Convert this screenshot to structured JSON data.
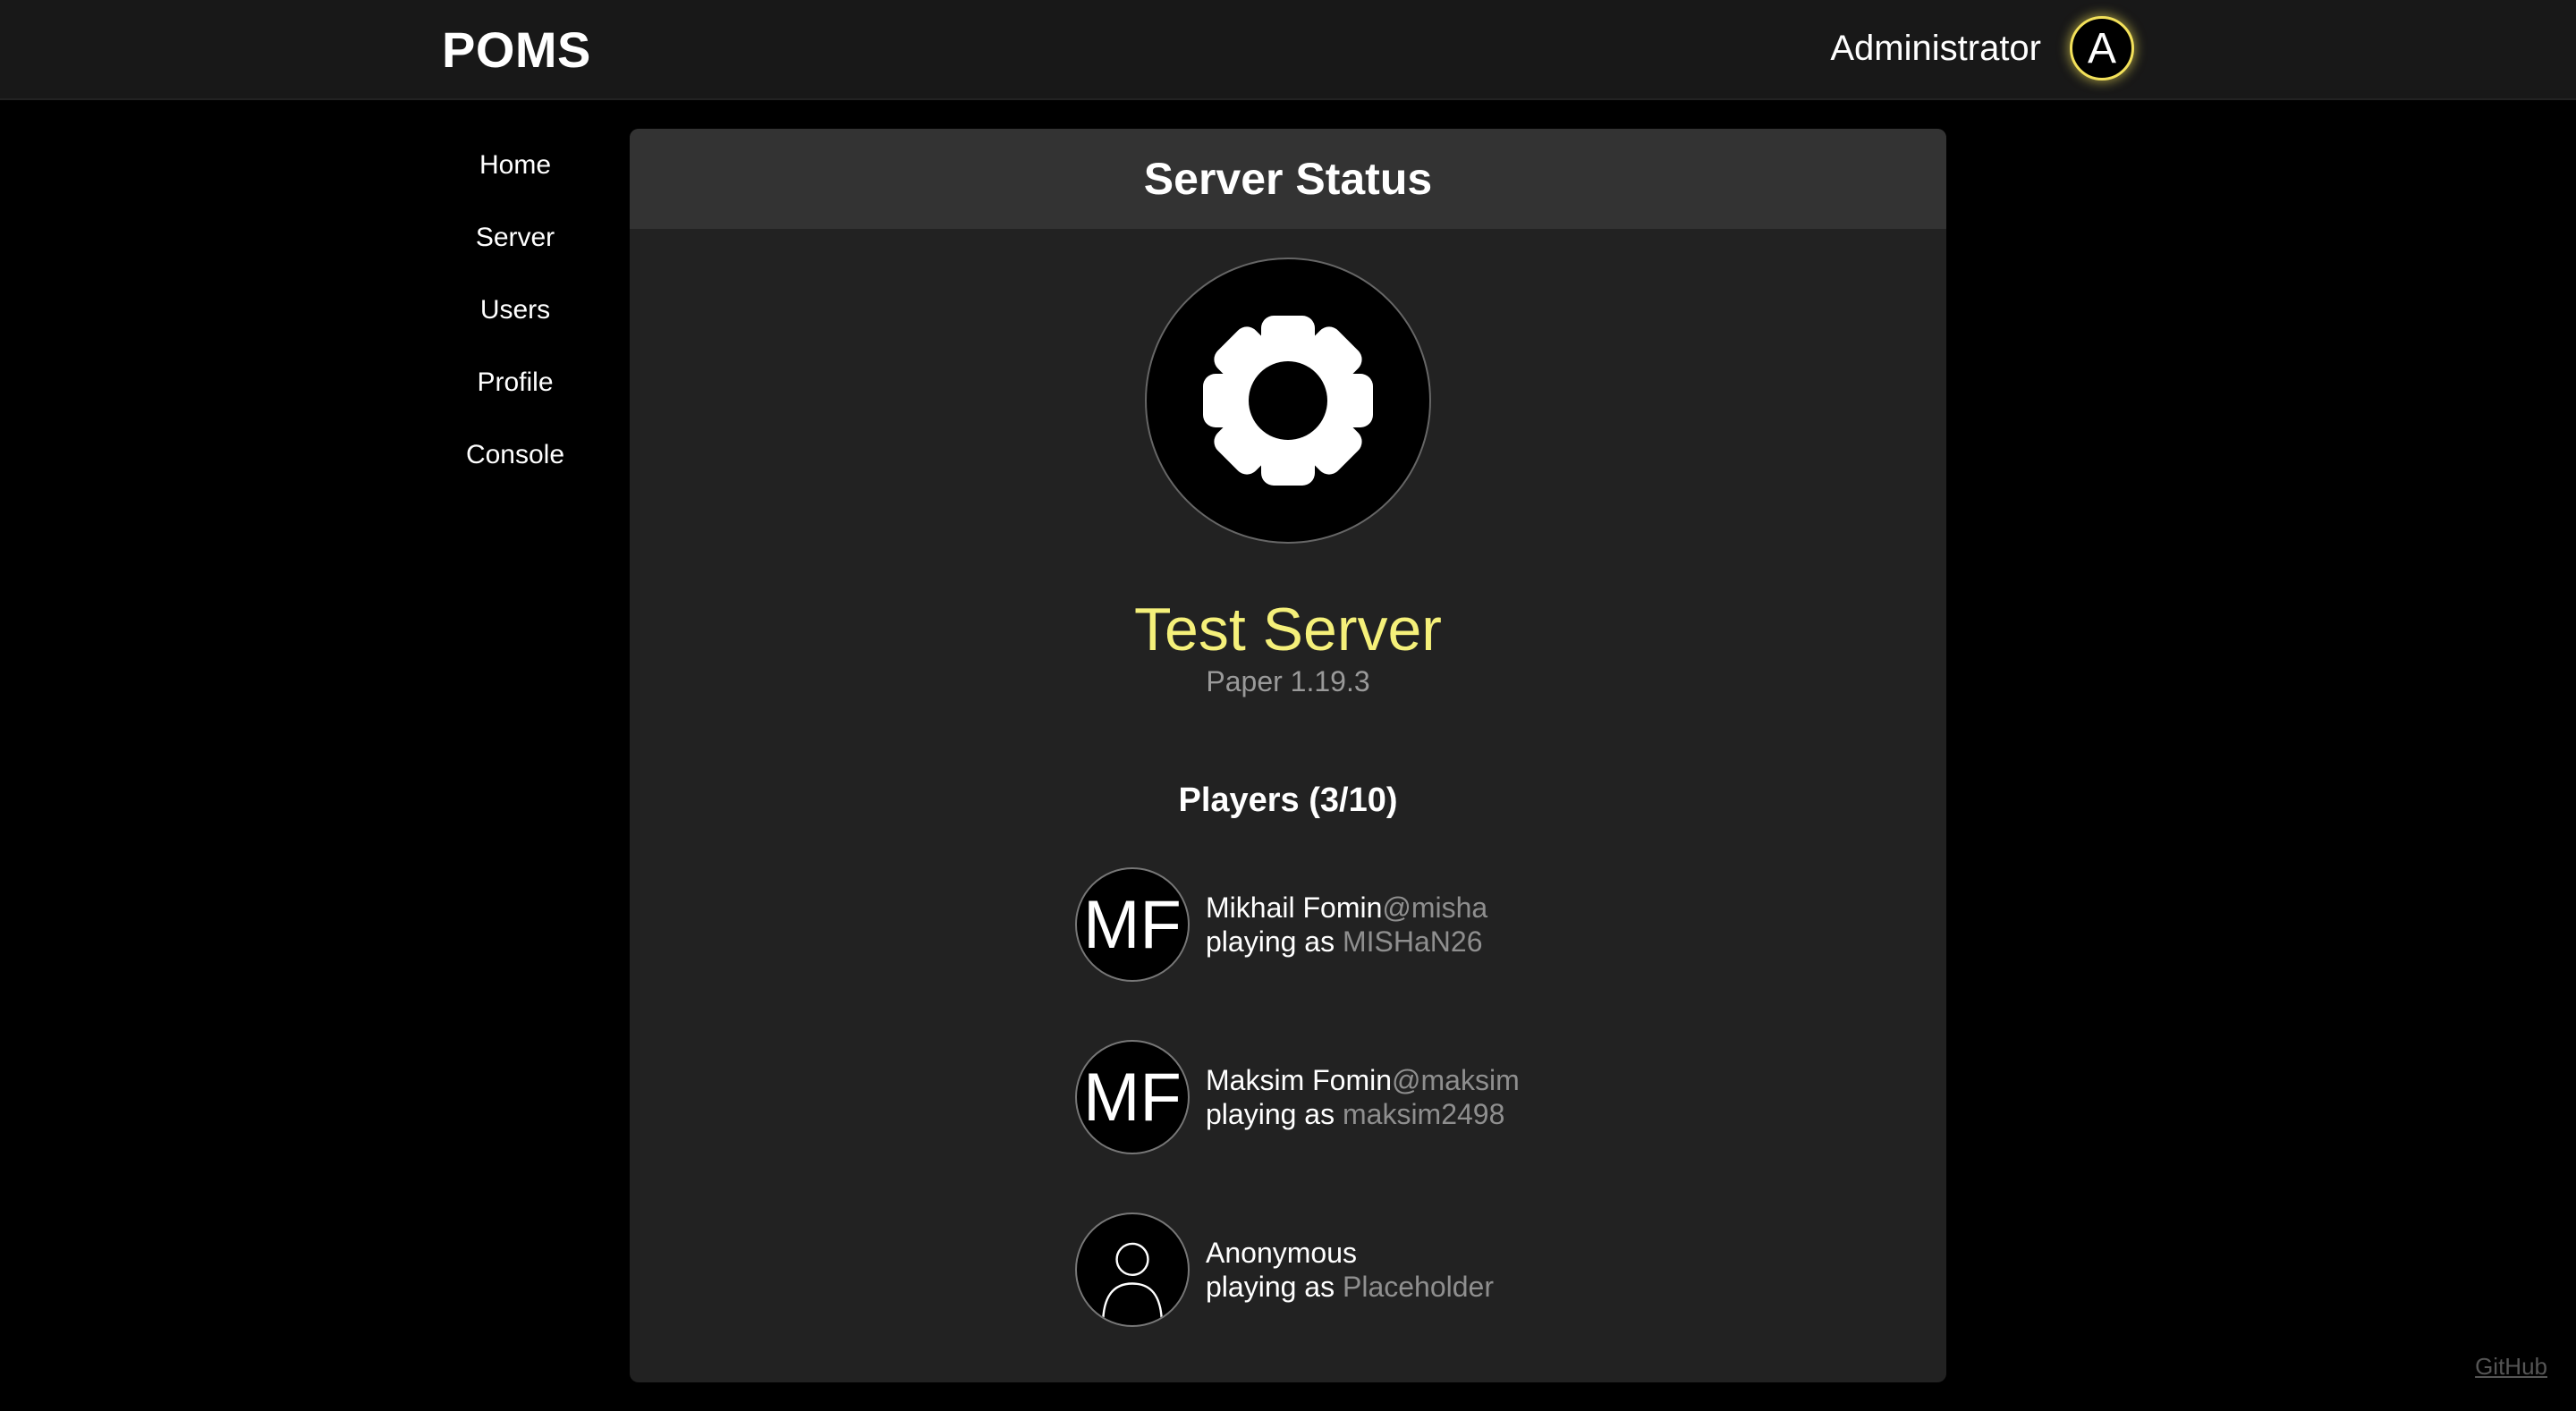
{
  "header": {
    "brand": "POMS",
    "user_name": "Administrator",
    "avatar_letter": "A",
    "accent_color": "#f3e15a"
  },
  "sidebar": {
    "items": [
      {
        "label": "Home"
      },
      {
        "label": "Server"
      },
      {
        "label": "Users"
      },
      {
        "label": "Profile"
      },
      {
        "label": "Console"
      }
    ]
  },
  "main": {
    "title": "Server Status",
    "server_icon": "gear-icon",
    "server_name": "Test Server",
    "server_version": "Paper 1.19.3",
    "players_title": "Players (3/10)",
    "players": [
      {
        "initials": "MF",
        "name": "Mikhail Fomin",
        "handle": "@misha",
        "playing_as_label": "playing as",
        "in_game_name": "MISHaN26"
      },
      {
        "initials": "MF",
        "name": "Maksim Fomin",
        "handle": "@maksim",
        "playing_as_label": "playing as",
        "in_game_name": "maksim2498"
      },
      {
        "initials": "",
        "name": "Anonymous",
        "handle": "",
        "playing_as_label": "playing as",
        "in_game_name": "Placeholder",
        "avatar_icon": "user-silhouette-icon"
      }
    ]
  },
  "footer": {
    "github_label": "GitHub"
  },
  "colors": {
    "server_name": "#f5f07a",
    "muted_text": "#8f8f8f",
    "panel_bg": "#222222",
    "panel_header_bg": "#333333"
  }
}
